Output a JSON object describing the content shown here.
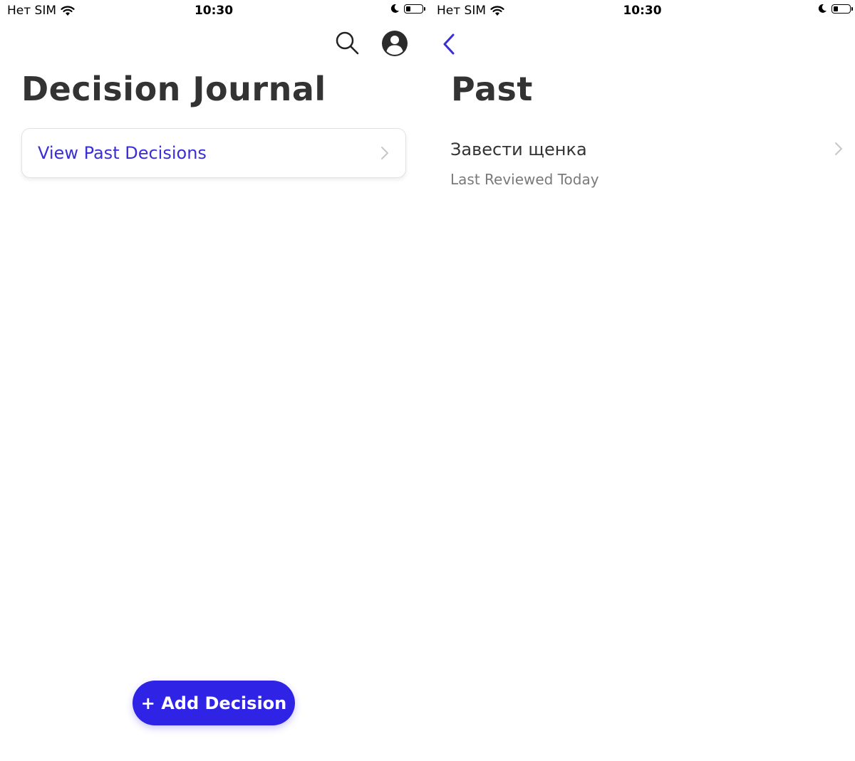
{
  "status_bar": {
    "carrier": "Нет SIM",
    "time": "10:30",
    "battery_level_percent": 30
  },
  "left_screen": {
    "toolbar": {
      "search_icon": "search-icon",
      "profile_icon": "user-circle-icon"
    },
    "title": "Decision Journal",
    "past_decisions_card": {
      "label": "View Past Decisions",
      "icon": "chevron-right-icon"
    },
    "fab_label": "+ Add Decision"
  },
  "right_screen": {
    "back_icon": "chevron-left-icon",
    "title": "Past",
    "items": [
      {
        "title": "Завести щенка",
        "subtitle": "Last Reviewed Today"
      }
    ]
  },
  "colors": {
    "accent": "#2f24e6",
    "link": "#3a2ed8",
    "text": "#333333",
    "secondary_text": "#7a7a7a"
  }
}
